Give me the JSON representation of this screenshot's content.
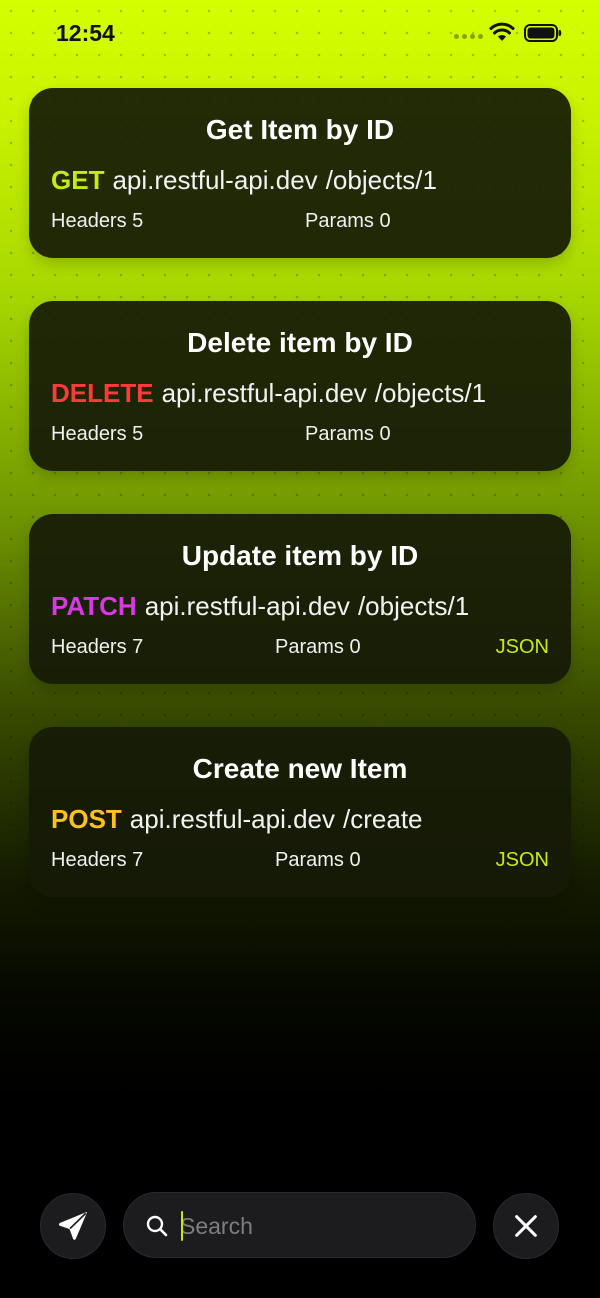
{
  "status_bar": {
    "time": "12:54"
  },
  "requests": [
    {
      "title": "Get Item by ID",
      "method": "GET",
      "method_color": "#c6ea16",
      "host": "api.restful-api.dev",
      "path": "/objects/1",
      "headers": "Headers 5",
      "params": "Params 0",
      "body_type": ""
    },
    {
      "title": "Delete item by ID",
      "method": "DELETE",
      "method_color": "#ff3b3b",
      "host": "api.restful-api.dev",
      "path": "/objects/1",
      "headers": "Headers 5",
      "params": "Params 0",
      "body_type": ""
    },
    {
      "title": "Update item by ID",
      "method": "PATCH",
      "method_color": "#d63ae0",
      "host": "api.restful-api.dev",
      "path": "/objects/1",
      "headers": "Headers 7",
      "params": "Params 0",
      "body_type": "JSON"
    },
    {
      "title": "Create new Item",
      "method": "POST",
      "method_color": "#ffc21a",
      "host": "api.restful-api.dev",
      "path": "/create",
      "headers": "Headers 7",
      "params": "Params 0",
      "body_type": "JSON"
    }
  ],
  "bottom_bar": {
    "send_icon": "paper-plane-icon",
    "search_placeholder": "Search",
    "search_value": "",
    "search_icon": "magnifier-icon",
    "close_icon": "close-icon"
  },
  "colors": {
    "accent": "#c6ea16",
    "background_top": "#d4ff00",
    "card": "#161a06"
  }
}
